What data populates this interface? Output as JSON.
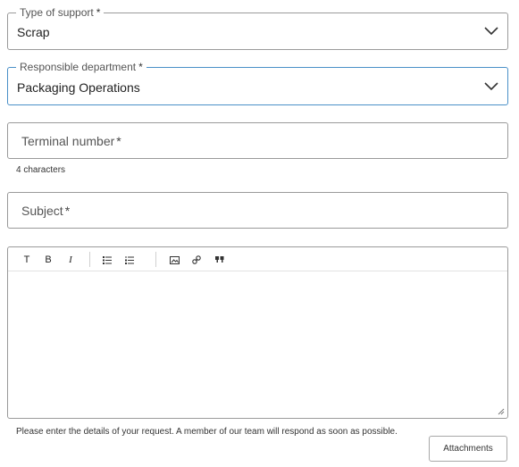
{
  "support_type": {
    "label": "Type of support",
    "required_mark": "*",
    "value": "Scrap",
    "icon": "chevron-down-icon"
  },
  "department": {
    "label": "Responsible department",
    "required_mark": "*",
    "value": "Packaging Operations",
    "icon": "chevron-down-icon"
  },
  "terminal": {
    "placeholder": "Terminal number",
    "required_mark": "*",
    "hint": "4 characters"
  },
  "subject": {
    "placeholder": "Subject",
    "required_mark": "*"
  },
  "editor": {
    "toolbar": {
      "text_style": "T",
      "bold": "B",
      "italic": "I",
      "bullet_list_icon": "bullet-list-icon",
      "numbered_list_icon": "numbered-list-icon",
      "image_icon": "image-icon",
      "link_icon": "link-icon",
      "quote_icon": "quote-icon"
    },
    "note": "Please enter the details of your request. A member of our team will respond as soon as possible."
  },
  "attachments_label": "Attachments",
  "colors": {
    "focus_border": "#4a90c8",
    "border": "#9a9a9a"
  }
}
